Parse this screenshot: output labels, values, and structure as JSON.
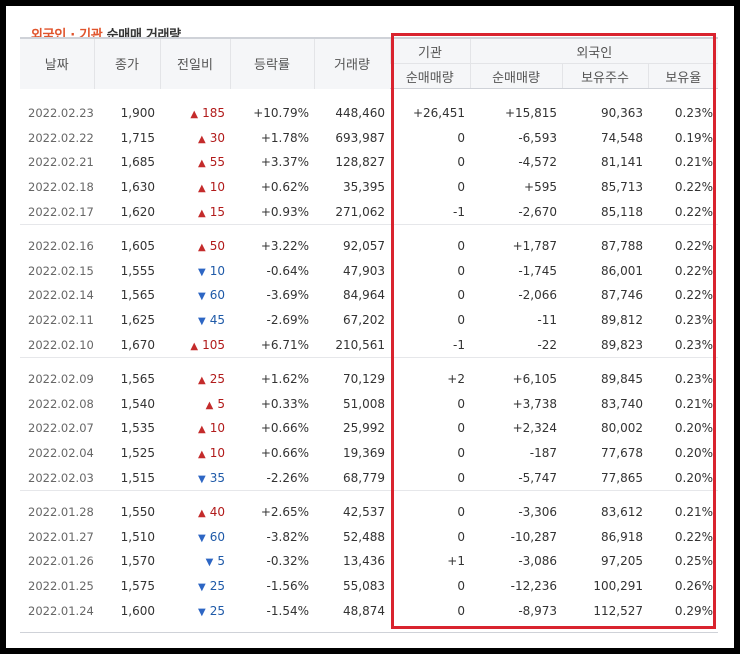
{
  "title": {
    "part1": "외국인 · 기관",
    "part2": "순매매 거래량"
  },
  "headers": {
    "date": "날짜",
    "close": "종가",
    "change": "전일비",
    "rate": "등락률",
    "volume": "거래량",
    "inst": "기관",
    "foreign": "외국인",
    "inst_net": "순매매량",
    "foreign_net": "순매매량",
    "holding": "보유주수",
    "ratio": "보유율"
  },
  "colors": {
    "up": "#b11b1b",
    "down": "#1f5aa8",
    "highlight": "#d9232e",
    "title_accent": "#e0542c"
  },
  "groups": [
    [
      {
        "date": "2022.02.23",
        "close": "1,900",
        "dir": "up",
        "change": "185",
        "rate": "+10.79%",
        "volume": "448,460",
        "inst": "+26,451",
        "foreign": "+15,815",
        "holding": "90,363",
        "ratio": "0.23%"
      },
      {
        "date": "2022.02.22",
        "close": "1,715",
        "dir": "up",
        "change": "30",
        "rate": "+1.78%",
        "volume": "693,987",
        "inst": "0",
        "foreign": "-6,593",
        "holding": "74,548",
        "ratio": "0.19%"
      },
      {
        "date": "2022.02.21",
        "close": "1,685",
        "dir": "up",
        "change": "55",
        "rate": "+3.37%",
        "volume": "128,827",
        "inst": "0",
        "foreign": "-4,572",
        "holding": "81,141",
        "ratio": "0.21%"
      },
      {
        "date": "2022.02.18",
        "close": "1,630",
        "dir": "up",
        "change": "10",
        "rate": "+0.62%",
        "volume": "35,395",
        "inst": "0",
        "foreign": "+595",
        "holding": "85,713",
        "ratio": "0.22%"
      },
      {
        "date": "2022.02.17",
        "close": "1,620",
        "dir": "up",
        "change": "15",
        "rate": "+0.93%",
        "volume": "271,062",
        "inst": "-1",
        "foreign": "-2,670",
        "holding": "85,118",
        "ratio": "0.22%"
      }
    ],
    [
      {
        "date": "2022.02.16",
        "close": "1,605",
        "dir": "up",
        "change": "50",
        "rate": "+3.22%",
        "volume": "92,057",
        "inst": "0",
        "foreign": "+1,787",
        "holding": "87,788",
        "ratio": "0.22%"
      },
      {
        "date": "2022.02.15",
        "close": "1,555",
        "dir": "down",
        "change": "10",
        "rate": "-0.64%",
        "volume": "47,903",
        "inst": "0",
        "foreign": "-1,745",
        "holding": "86,001",
        "ratio": "0.22%"
      },
      {
        "date": "2022.02.14",
        "close": "1,565",
        "dir": "down",
        "change": "60",
        "rate": "-3.69%",
        "volume": "84,964",
        "inst": "0",
        "foreign": "-2,066",
        "holding": "87,746",
        "ratio": "0.22%"
      },
      {
        "date": "2022.02.11",
        "close": "1,625",
        "dir": "down",
        "change": "45",
        "rate": "-2.69%",
        "volume": "67,202",
        "inst": "0",
        "foreign": "-11",
        "holding": "89,812",
        "ratio": "0.23%"
      },
      {
        "date": "2022.02.10",
        "close": "1,670",
        "dir": "up",
        "change": "105",
        "rate": "+6.71%",
        "volume": "210,561",
        "inst": "-1",
        "foreign": "-22",
        "holding": "89,823",
        "ratio": "0.23%"
      }
    ],
    [
      {
        "date": "2022.02.09",
        "close": "1,565",
        "dir": "up",
        "change": "25",
        "rate": "+1.62%",
        "volume": "70,129",
        "inst": "+2",
        "foreign": "+6,105",
        "holding": "89,845",
        "ratio": "0.23%"
      },
      {
        "date": "2022.02.08",
        "close": "1,540",
        "dir": "up",
        "change": "5",
        "rate": "+0.33%",
        "volume": "51,008",
        "inst": "0",
        "foreign": "+3,738",
        "holding": "83,740",
        "ratio": "0.21%"
      },
      {
        "date": "2022.02.07",
        "close": "1,535",
        "dir": "up",
        "change": "10",
        "rate": "+0.66%",
        "volume": "25,992",
        "inst": "0",
        "foreign": "+2,324",
        "holding": "80,002",
        "ratio": "0.20%"
      },
      {
        "date": "2022.02.04",
        "close": "1,525",
        "dir": "up",
        "change": "10",
        "rate": "+0.66%",
        "volume": "19,369",
        "inst": "0",
        "foreign": "-187",
        "holding": "77,678",
        "ratio": "0.20%"
      },
      {
        "date": "2022.02.03",
        "close": "1,515",
        "dir": "down",
        "change": "35",
        "rate": "-2.26%",
        "volume": "68,779",
        "inst": "0",
        "foreign": "-5,747",
        "holding": "77,865",
        "ratio": "0.20%"
      }
    ],
    [
      {
        "date": "2022.01.28",
        "close": "1,550",
        "dir": "up",
        "change": "40",
        "rate": "+2.65%",
        "volume": "42,537",
        "inst": "0",
        "foreign": "-3,306",
        "holding": "83,612",
        "ratio": "0.21%"
      },
      {
        "date": "2022.01.27",
        "close": "1,510",
        "dir": "down",
        "change": "60",
        "rate": "-3.82%",
        "volume": "52,488",
        "inst": "0",
        "foreign": "-10,287",
        "holding": "86,918",
        "ratio": "0.22%"
      },
      {
        "date": "2022.01.26",
        "close": "1,570",
        "dir": "down",
        "change": "5",
        "rate": "-0.32%",
        "volume": "13,436",
        "inst": "+1",
        "foreign": "-3,086",
        "holding": "97,205",
        "ratio": "0.25%"
      },
      {
        "date": "2022.01.25",
        "close": "1,575",
        "dir": "down",
        "change": "25",
        "rate": "-1.56%",
        "volume": "55,083",
        "inst": "0",
        "foreign": "-12,236",
        "holding": "100,291",
        "ratio": "0.26%"
      },
      {
        "date": "2022.01.24",
        "close": "1,600",
        "dir": "down",
        "change": "25",
        "rate": "-1.54%",
        "volume": "48,874",
        "inst": "0",
        "foreign": "-8,973",
        "holding": "112,527",
        "ratio": "0.29%"
      }
    ]
  ]
}
